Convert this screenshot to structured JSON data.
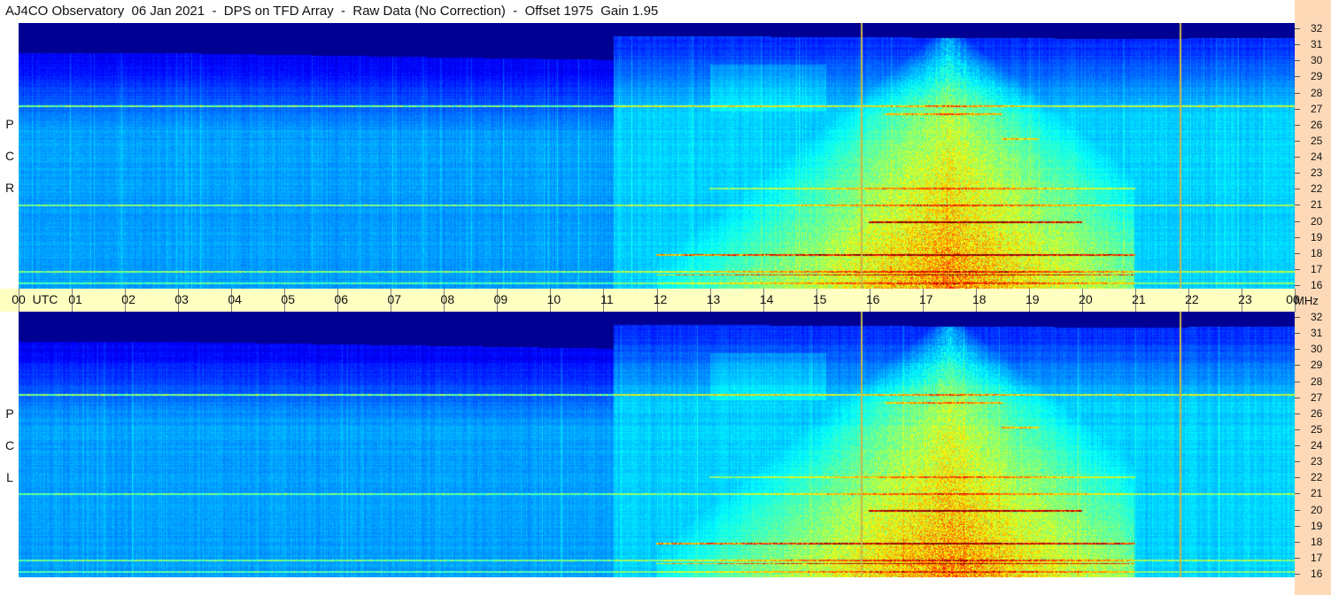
{
  "title": "AJ4CO Observatory  06 Jan 2021  -  DPS on TFD Array  -  Raw Data (No Correction)  -  Offset 1975  Gain 1.95",
  "chart_data": [
    {
      "type": "heatmap",
      "panel": "top",
      "polarization_label": [
        "R",
        "C",
        "P"
      ],
      "x_label": "UTC",
      "x_ticks": [
        "00",
        "01",
        "02",
        "03",
        "04",
        "05",
        "06",
        "07",
        "08",
        "09",
        "10",
        "11",
        "12",
        "13",
        "14",
        "15",
        "16",
        "17",
        "18",
        "19",
        "20",
        "21",
        "22",
        "23",
        "00"
      ],
      "y_unit": "MHz",
      "y_ticks": [
        "16",
        "17",
        "18",
        "19",
        "20",
        "21",
        "22",
        "23",
        "24",
        "25",
        "26",
        "27",
        "28",
        "29",
        "30",
        "31",
        "32"
      ],
      "x_range_hours": [
        0,
        24
      ],
      "y_range_mhz": [
        16,
        32
      ],
      "markers_utc_hours": [
        15.87,
        21.87
      ],
      "gain_step_utc_hour": 11.2,
      "solar_emission_window_hours": [
        12,
        21
      ],
      "colormap": "jet"
    },
    {
      "type": "heatmap",
      "panel": "bottom",
      "polarization_label": [
        "L",
        "C",
        "P"
      ],
      "x_label": "UTC",
      "x_ticks": [
        "00",
        "01",
        "02",
        "03",
        "04",
        "05",
        "06",
        "07",
        "08",
        "09",
        "10",
        "11",
        "12",
        "13",
        "14",
        "15",
        "16",
        "17",
        "18",
        "19",
        "20",
        "21",
        "22",
        "23",
        "00"
      ],
      "y_unit": "MHz",
      "y_ticks": [
        "16",
        "17",
        "18",
        "19",
        "20",
        "21",
        "22",
        "23",
        "24",
        "25",
        "26",
        "27",
        "28",
        "29",
        "30",
        "31",
        "32"
      ],
      "x_range_hours": [
        0,
        24
      ],
      "y_range_mhz": [
        16,
        32
      ],
      "markers_utc_hours": [
        15.87,
        21.87
      ],
      "gain_step_utc_hour": 11.2,
      "solar_emission_window_hours": [
        12,
        21
      ],
      "colormap": "jet"
    }
  ],
  "time_axis": {
    "first_label": "00",
    "utc_label": "UTC",
    "unit_label": "MHz"
  },
  "colors": {
    "background_strip": "#fdd9b8",
    "time_bar": "#ffffc2",
    "marker_line": "#c8b84a",
    "noise_floor": "#0a3fd0",
    "dark": "#000418"
  }
}
